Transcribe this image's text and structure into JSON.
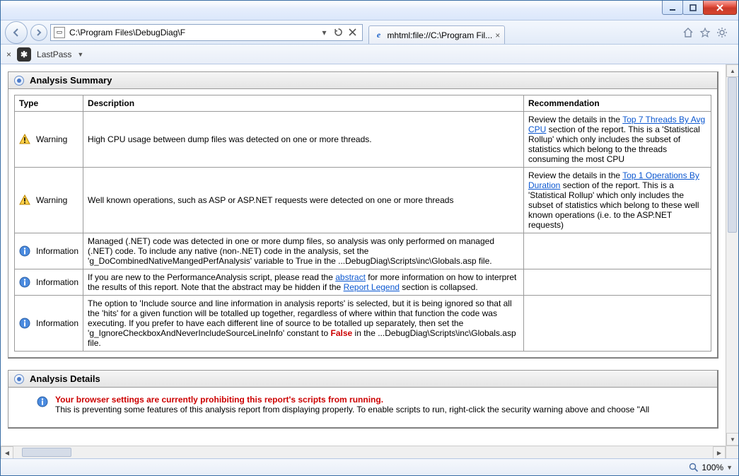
{
  "address_bar": {
    "path": "C:\\Program Files\\DebugDiag\\F"
  },
  "tab": {
    "title": "mhtml:file://C:\\Program Fil..."
  },
  "lastpass": {
    "label": "LastPass"
  },
  "panels": {
    "summary_title": "Analysis Summary",
    "details_title": "Analysis Details"
  },
  "columns": {
    "type": "Type",
    "desc": "Description",
    "rec": "Recommendation"
  },
  "types": {
    "warning": "Warning",
    "info": "Information"
  },
  "rows": {
    "r0": {
      "desc": "High CPU usage between dump files was detected on one or more threads.",
      "rec_a": "Review the details in the ",
      "rec_link": "Top 7 Threads By Avg CPU",
      "rec_b": " section of the report. This is a 'Statistical Rollup' which only includes the subset of statistics which belong to the threads consuming the most CPU"
    },
    "r1": {
      "desc": "Well known operations, such as ASP or ASP.NET requests were detected on one or more threads",
      "rec_a": "Review the details in the ",
      "rec_link": "Top 1 Operations By Duration",
      "rec_b": " section of the report. This is a 'Statistical Rollup' which only includes the subset of statistics which belong to these well known operations (i.e. to the ASP.NET requests)"
    },
    "r2": {
      "desc": "Managed (.NET) code was detected in one or more dump files, so analysis was only performed on managed (.NET) code. To include any native (non-.NET) code in the analysis, set the 'g_DoCombinedNativeMangedPerfAnalysis' variable to True in the ...DebugDiag\\Scripts\\inc\\Globals.asp file."
    },
    "r3": {
      "desc_a": "If you are new to the PerformanceAnalysis script, please read the ",
      "link1": "abstract",
      "desc_b": " for more information on how to interpret the results of this report.   Note that the abstract may be hidden if the ",
      "link2": "Report Legend",
      "desc_c": " section is collapsed."
    },
    "r4": {
      "desc_a": "The option to 'Include source and line information in analysis reports' is selected, but it is being ignored so that all the 'hits' for a given function will be totalled up together, regardless of where within that function the code was executing. If you prefer to have each different line of source to be totalled up separately, then set the 'g_IgnoreCheckboxAndNeverIncludeSourceLineInfo' constant to ",
      "false_word": "False",
      "desc_b": " in the ...DebugDiag\\Scripts\\inc\\Globals.asp file."
    }
  },
  "details": {
    "headline": "Your browser settings are currently prohibiting this report's scripts from running.",
    "body": "This is preventing some features of this analysis report from displaying properly. To enable scripts to run, right-click the security warning above and choose \"All"
  },
  "status": {
    "zoom": "100%"
  }
}
